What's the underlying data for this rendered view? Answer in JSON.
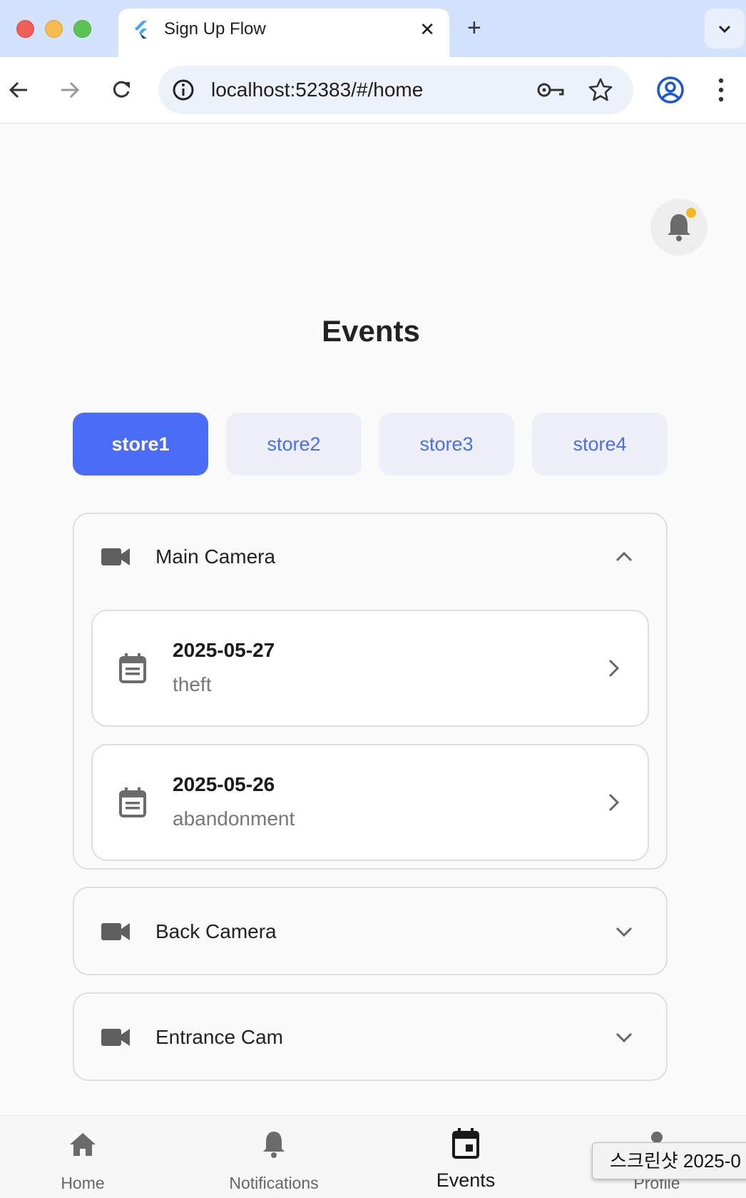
{
  "browser": {
    "tab_title": "Sign Up Flow",
    "tab_close": "✕",
    "new_tab": "+",
    "url": "localhost:52383/#/home"
  },
  "app": {
    "title": "Events",
    "notification_dot_color": "#f5b825",
    "accent_color": "#4a6cf7",
    "store_tabs": [
      {
        "label": "store1",
        "active": true
      },
      {
        "label": "store2",
        "active": false
      },
      {
        "label": "store3",
        "active": false
      },
      {
        "label": "store4",
        "active": false
      }
    ],
    "cameras": [
      {
        "name": "Main Camera",
        "expanded": true,
        "icon": "videocam-icon",
        "events": [
          {
            "date": "2025-05-27",
            "type": "theft"
          },
          {
            "date": "2025-05-26",
            "type": "abandonment"
          }
        ]
      },
      {
        "name": "Back Camera",
        "expanded": false,
        "icon": "videocam-icon",
        "events": []
      },
      {
        "name": "Entrance Cam",
        "expanded": false,
        "icon": "videocam-icon",
        "events": []
      }
    ],
    "bottom_nav": [
      {
        "label": "Home",
        "icon": "home-icon",
        "active": false
      },
      {
        "label": "Notifications",
        "icon": "bell-icon",
        "active": false
      },
      {
        "label": "Events",
        "icon": "calendar-icon",
        "active": true
      },
      {
        "label": "Profile",
        "icon": "person-icon",
        "active": false
      }
    ]
  },
  "overlay": {
    "screenshot_label": "스크린샷 2025-0"
  }
}
